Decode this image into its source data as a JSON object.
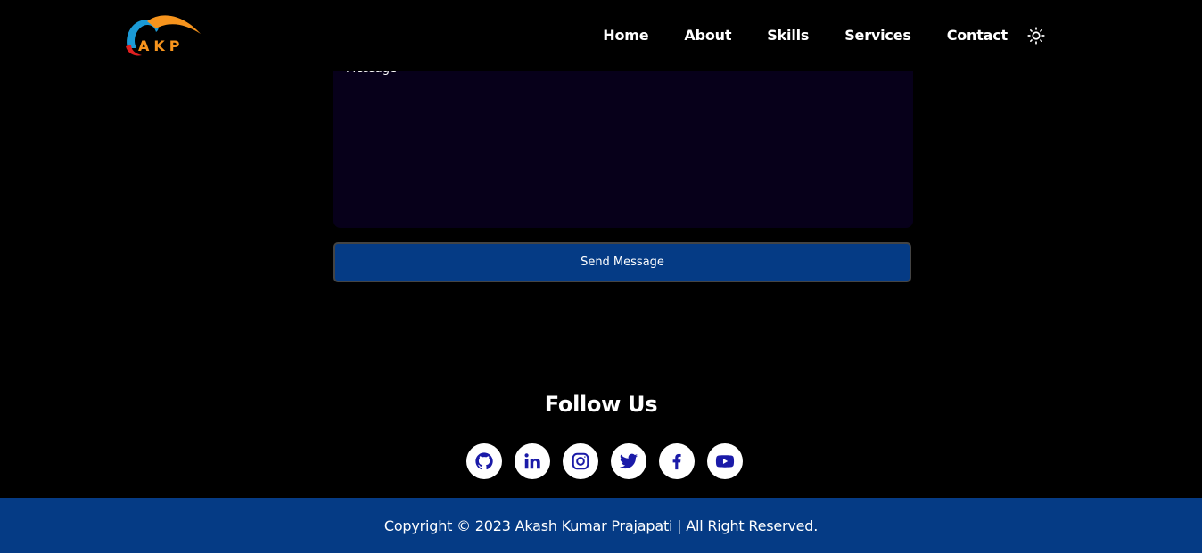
{
  "brand": {
    "logo_text": "AKP",
    "colors": {
      "orange": "#f7941d",
      "blue": "#1b9ad6",
      "red": "#e02020"
    }
  },
  "nav": {
    "items": [
      {
        "label": "Home"
      },
      {
        "label": "About"
      },
      {
        "label": "Skills"
      },
      {
        "label": "Services"
      },
      {
        "label": "Contact"
      }
    ],
    "theme_icon": "sun-icon"
  },
  "contact_form": {
    "message_placeholder": "Message",
    "send_label": "Send Message"
  },
  "follow": {
    "title": "Follow Us",
    "icons": [
      "github-icon",
      "linkedin-icon",
      "instagram-icon",
      "twitter-icon",
      "facebook-icon",
      "youtube-icon"
    ]
  },
  "footer": {
    "copyright": "Copyright © 2023 Akash Kumar Prajapati | All Right Reserved."
  },
  "colors": {
    "page_bg": "#000000",
    "textarea_bg": "#07001a",
    "accent": "#053b85",
    "icon_color": "#1a1aa8"
  }
}
